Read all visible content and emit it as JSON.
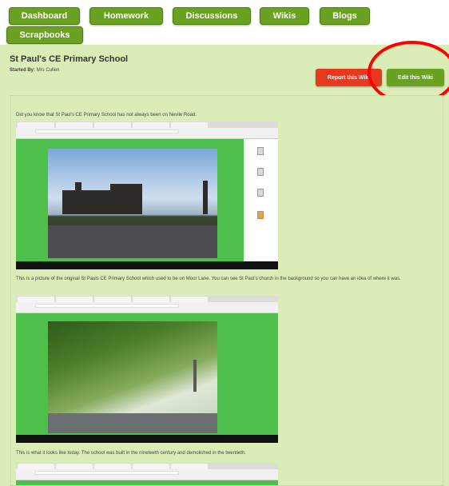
{
  "nav": {
    "items": [
      {
        "label": "Dashboard"
      },
      {
        "label": "Homework"
      },
      {
        "label": "Discussions"
      },
      {
        "label": "Wikis"
      },
      {
        "label": "Blogs"
      },
      {
        "label": "Scrapbooks"
      }
    ]
  },
  "wiki": {
    "title": "St Paul's CE Primary School",
    "started_by_label": "Started By:",
    "started_by_name": "Mrs Cullen",
    "report_label": "Report this Wiki",
    "edit_label": "Edit this Wiki"
  },
  "content": {
    "paragraphs": [
      "Did you know that St Paul's CE Primary School has not always been on Nevile Road.",
      "This is a picture of the original St Pauls CE Primary School which used to be on Moor Lane.  You can see St Paul's church in the background so you can have an idea of where it was.",
      "This is what it looks like today.  The school was built in the nineteeth century and demolished in the twentieth."
    ]
  },
  "colors": {
    "nav_green": "#6aa121",
    "page_bg": "#dbedb6",
    "report_red": "#e8381e",
    "annotation_red": "#ff0000"
  }
}
